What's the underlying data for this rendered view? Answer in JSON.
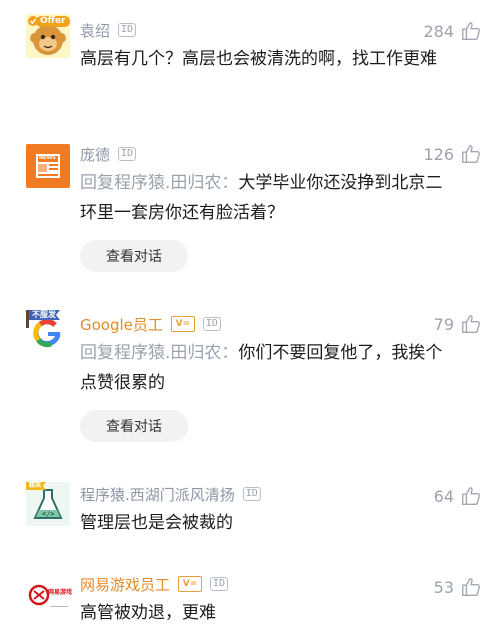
{
  "comments": [
    {
      "name": "袁绍",
      "id_badge": "ID",
      "likes": "284",
      "avatar": "monkey-offer-avatar",
      "offer_label": "Offer",
      "text": "高层有几个？高层也会被清洗的啊，找工作更难"
    },
    {
      "name": "庞德",
      "id_badge": "ID",
      "likes": "126",
      "avatar": "news-avatar",
      "news_label": "NEWS",
      "reply_prefix": "回复",
      "reply_to": "程序猿.田归农：",
      "text": "大学毕业你还没挣到北京二环里一套房你还有脸活着？",
      "button": "查看对话"
    },
    {
      "name": "Google员工",
      "vtag": "V=",
      "id_badge": "ID",
      "likes": "79",
      "avatar": "google-avatar",
      "flag_label": "不服发",
      "reply_prefix": "回复",
      "reply_to": "程序猿.田归农：",
      "text": "你们不要回复他了，我挨个点赞很累的",
      "button": "查看对话"
    },
    {
      "name": "程序猿.西湖门派风清扬",
      "id_badge": "ID",
      "likes": "64",
      "avatar": "code-flask-avatar",
      "flag_label": "精英",
      "code_label": "</>",
      "text": "管理层也是会被裁的"
    },
    {
      "name": "网易游戏员工",
      "vtag": "V=",
      "id_badge": "ID",
      "likes": "53",
      "avatar": "netease-avatar",
      "logo_label": "网易游戏",
      "text": "高管被劝退，更难"
    }
  ],
  "colors": {
    "name_gray": "#8d96a5",
    "name_orange": "#e38b2b",
    "like_gray": "#9ca3ad"
  }
}
